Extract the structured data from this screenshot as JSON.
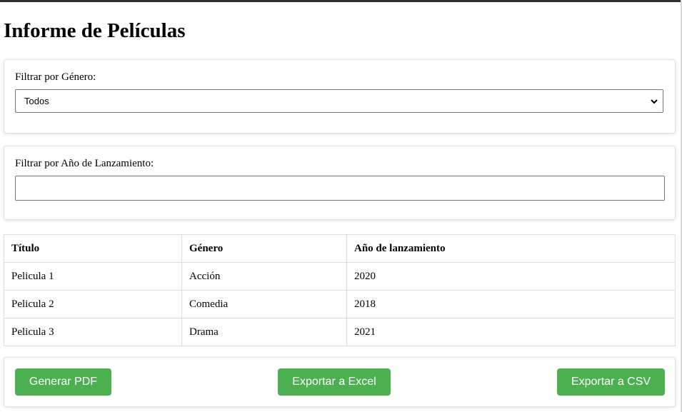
{
  "page": {
    "title": "Informe de Películas"
  },
  "filters": {
    "genre": {
      "label": "Filtrar por Género:",
      "selected": "Todos"
    },
    "year": {
      "label": "Filtrar por Año de Lanzamiento:",
      "value": ""
    }
  },
  "table": {
    "headers": [
      "Título",
      "Género",
      "Año de lanzamiento"
    ],
    "rows": [
      [
        "Pelicula 1",
        "Acción",
        "2020"
      ],
      [
        "Pelicula 2",
        "Comedia",
        "2018"
      ],
      [
        "Pelicula 3",
        "Drama",
        "2021"
      ]
    ]
  },
  "actions": {
    "pdf_label": "Generar PDF",
    "excel_label": "Exportar a Excel",
    "csv_label": "Exportar a CSV"
  },
  "colors": {
    "button_bg": "#4caf50",
    "top_bar": "#2b2f36"
  },
  "icons": {
    "select_arrow": "chevron-down-icon"
  }
}
